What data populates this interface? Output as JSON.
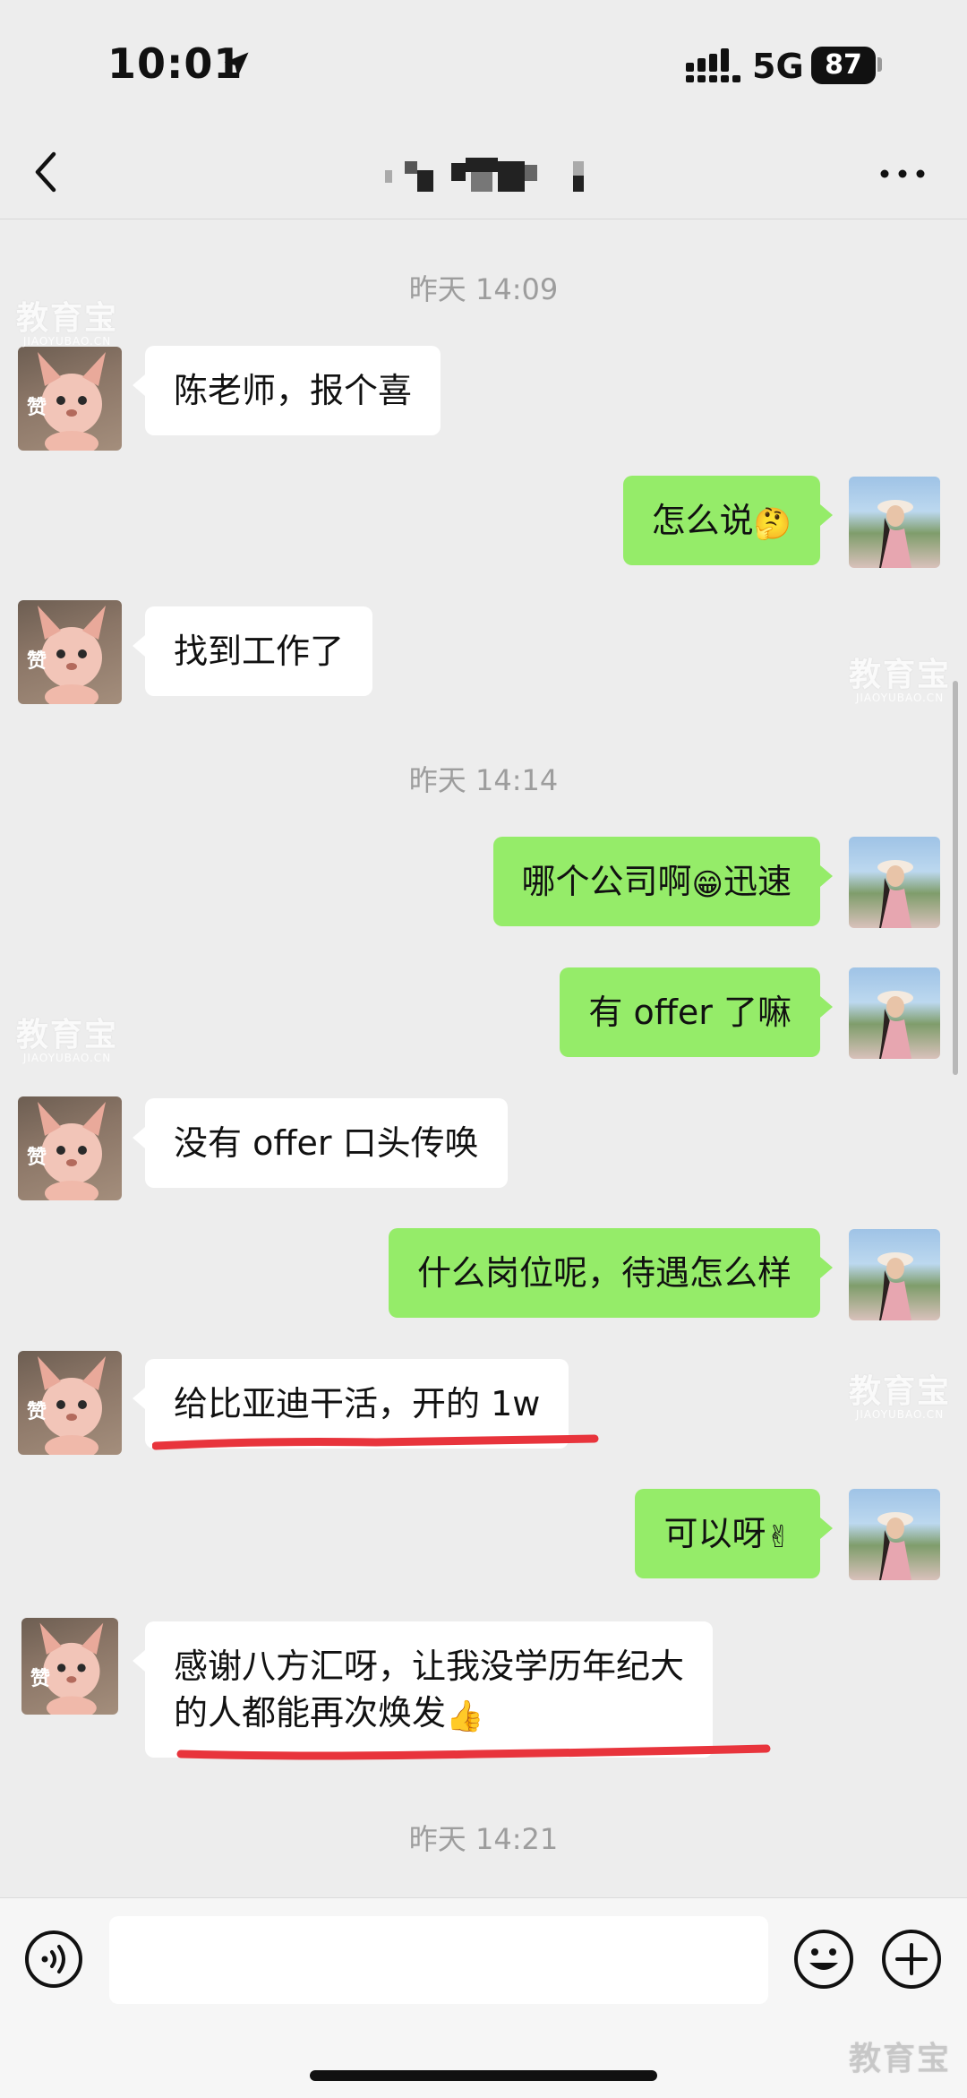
{
  "status_bar": {
    "time": "10:01",
    "network": "5G",
    "battery": "87"
  },
  "nav": {
    "title": "",
    "back_icon": "chevron-left-icon",
    "more_icon": "ellipsis-icon"
  },
  "messages": {
    "ts1": "昨天 14:09",
    "m1": "陈老师，报个喜",
    "m2": "怎么说",
    "m2_emoji": "🤔",
    "m3": "找到工作了",
    "ts2": "昨天 14:14",
    "m4a": "哪个公司啊",
    "m4_emoji": "😁",
    "m4b": "迅速",
    "m5": "有 offer 了嘛",
    "m6": "没有 offer 口头传唤",
    "m7": "什么岗位呢，待遇怎么样",
    "m8": "给比亚迪干活，开的 1w",
    "m9": "可以呀",
    "m9_emoji": "✌",
    "m10_line1": "感谢八方汇呀，让我没学历年纪大",
    "m10_line2": "的人都能再次焕发",
    "m10_emoji": "👍",
    "ts3": "昨天 14:21"
  },
  "avatar_badge": "赞",
  "watermark": {
    "main": "教育宝",
    "sub": "JIAOYUBAO.CN"
  },
  "input_bar": {
    "placeholder": "",
    "voice_icon": "voice-icon",
    "emoji_icon": "smiley-icon",
    "plus_icon": "plus-icon"
  },
  "colors": {
    "background": "#ededed",
    "bubble_self": "#95ec69",
    "bubble_other": "#ffffff",
    "timestamp": "#9d9d9d",
    "underline": "#e8343c"
  }
}
